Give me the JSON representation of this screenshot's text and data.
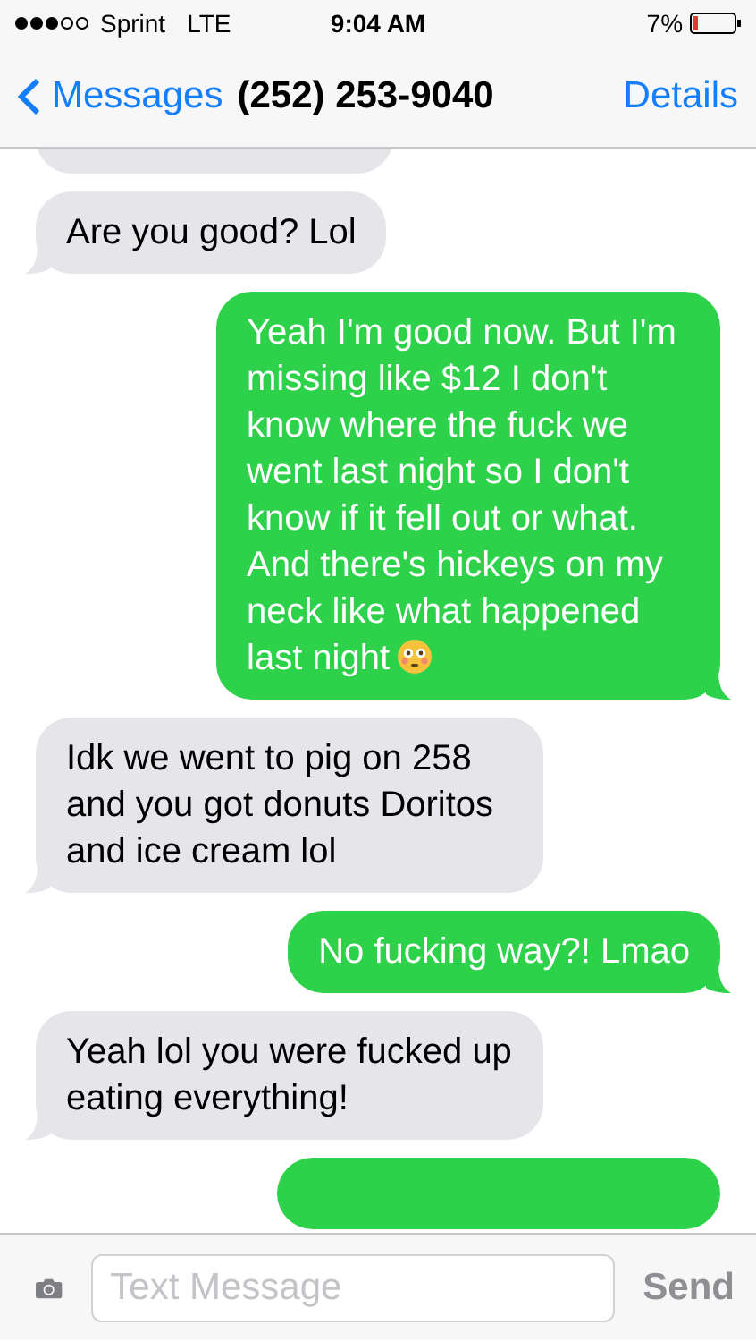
{
  "status_bar": {
    "carrier": "Sprint",
    "network": "LTE",
    "time": "9:04 AM",
    "battery": "7%"
  },
  "nav": {
    "back": "Messages",
    "title": "(252) 253-9040",
    "action": "Details"
  },
  "messages": [
    {
      "kind": "received",
      "clipped": true
    },
    {
      "kind": "received",
      "text": "Are you good? Lol"
    },
    {
      "kind": "sent",
      "text": "Yeah I'm good now. But I'm missing like $12 I don't know where the fuck we went last night so I don't know if it fell out or what. And there's hickeys on my neck like what happened last night",
      "trailing_emoji": true
    },
    {
      "kind": "received",
      "text": "Idk we went to pig on 258 and you got donuts Doritos and ice cream lol"
    },
    {
      "kind": "sent",
      "text": "No fucking way?! Lmao"
    },
    {
      "kind": "received",
      "text": "Yeah lol you were fucked up eating everything!"
    },
    {
      "kind": "sent",
      "clipped": true
    }
  ],
  "composer": {
    "placeholder": "Text Message",
    "send": "Send"
  }
}
